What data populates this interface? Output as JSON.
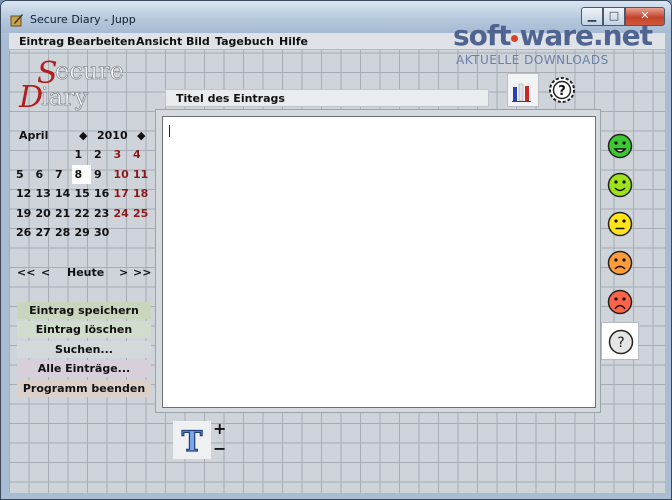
{
  "window": {
    "title": "Secure Diary - Jupp"
  },
  "watermark": {
    "brand_left": "soft",
    "brand_right": "ware.net",
    "tagline": "AKTUELLE DOWNLOADS"
  },
  "menubar": [
    "Eintrag",
    "Bearbeiten",
    "Ansicht",
    "Bild",
    "Tagebuch",
    "Hilfe"
  ],
  "logo": {
    "line1": "Secure",
    "line2": "Diary"
  },
  "entry": {
    "title_label": "Titel des Eintrags",
    "text": ""
  },
  "calendar": {
    "month": "April",
    "year": "2010",
    "nav_prev_year": "<<",
    "nav_prev_month": "<",
    "nav_today": "Heute",
    "nav_next_month": ">",
    "nav_next_year": ">>",
    "weeks": [
      [
        "",
        "",
        "",
        "1",
        "2",
        "3",
        "4"
      ],
      [
        "5",
        "6",
        "7",
        "8",
        "9",
        "10",
        "11"
      ],
      [
        "12",
        "13",
        "14",
        "15",
        "16",
        "17",
        "18"
      ],
      [
        "19",
        "20",
        "21",
        "22",
        "23",
        "24",
        "25"
      ],
      [
        "26",
        "27",
        "28",
        "29",
        "30",
        "",
        ""
      ]
    ],
    "selected_day": "8"
  },
  "actions": {
    "save": "Eintrag speichern",
    "delete": "Eintrag löschen",
    "search": "Suchen...",
    "all": "Alle Einträge...",
    "quit": "Programm beenden"
  },
  "moods": [
    {
      "icon": "very-happy-icon",
      "color": "#3cc832"
    },
    {
      "icon": "happy-icon",
      "color": "#9fe21a"
    },
    {
      "icon": "neutral-icon",
      "color": "#ffe419"
    },
    {
      "icon": "sad-icon",
      "color": "#ff9c3a"
    },
    {
      "icon": "very-sad-icon",
      "color": "#ff6448"
    },
    {
      "icon": "unknown-mood-icon",
      "color": "#e5e5e5",
      "selected": true
    }
  ],
  "font_controls": {
    "increase": "+",
    "decrease": "−"
  }
}
